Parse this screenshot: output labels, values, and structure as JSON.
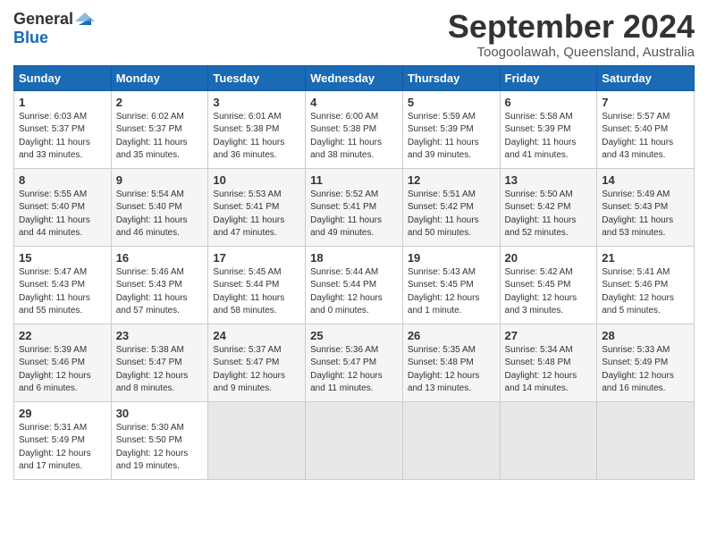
{
  "header": {
    "logo_general": "General",
    "logo_blue": "Blue",
    "month_title": "September 2024",
    "location": "Toogoolawah, Queensland, Australia"
  },
  "weekdays": [
    "Sunday",
    "Monday",
    "Tuesday",
    "Wednesday",
    "Thursday",
    "Friday",
    "Saturday"
  ],
  "weeks": [
    [
      {
        "day": "1",
        "info": "Sunrise: 6:03 AM\nSunset: 5:37 PM\nDaylight: 11 hours\nand 33 minutes."
      },
      {
        "day": "2",
        "info": "Sunrise: 6:02 AM\nSunset: 5:37 PM\nDaylight: 11 hours\nand 35 minutes."
      },
      {
        "day": "3",
        "info": "Sunrise: 6:01 AM\nSunset: 5:38 PM\nDaylight: 11 hours\nand 36 minutes."
      },
      {
        "day": "4",
        "info": "Sunrise: 6:00 AM\nSunset: 5:38 PM\nDaylight: 11 hours\nand 38 minutes."
      },
      {
        "day": "5",
        "info": "Sunrise: 5:59 AM\nSunset: 5:39 PM\nDaylight: 11 hours\nand 39 minutes."
      },
      {
        "day": "6",
        "info": "Sunrise: 5:58 AM\nSunset: 5:39 PM\nDaylight: 11 hours\nand 41 minutes."
      },
      {
        "day": "7",
        "info": "Sunrise: 5:57 AM\nSunset: 5:40 PM\nDaylight: 11 hours\nand 43 minutes."
      }
    ],
    [
      {
        "day": "8",
        "info": "Sunrise: 5:55 AM\nSunset: 5:40 PM\nDaylight: 11 hours\nand 44 minutes."
      },
      {
        "day": "9",
        "info": "Sunrise: 5:54 AM\nSunset: 5:40 PM\nDaylight: 11 hours\nand 46 minutes."
      },
      {
        "day": "10",
        "info": "Sunrise: 5:53 AM\nSunset: 5:41 PM\nDaylight: 11 hours\nand 47 minutes."
      },
      {
        "day": "11",
        "info": "Sunrise: 5:52 AM\nSunset: 5:41 PM\nDaylight: 11 hours\nand 49 minutes."
      },
      {
        "day": "12",
        "info": "Sunrise: 5:51 AM\nSunset: 5:42 PM\nDaylight: 11 hours\nand 50 minutes."
      },
      {
        "day": "13",
        "info": "Sunrise: 5:50 AM\nSunset: 5:42 PM\nDaylight: 11 hours\nand 52 minutes."
      },
      {
        "day": "14",
        "info": "Sunrise: 5:49 AM\nSunset: 5:43 PM\nDaylight: 11 hours\nand 53 minutes."
      }
    ],
    [
      {
        "day": "15",
        "info": "Sunrise: 5:47 AM\nSunset: 5:43 PM\nDaylight: 11 hours\nand 55 minutes."
      },
      {
        "day": "16",
        "info": "Sunrise: 5:46 AM\nSunset: 5:43 PM\nDaylight: 11 hours\nand 57 minutes."
      },
      {
        "day": "17",
        "info": "Sunrise: 5:45 AM\nSunset: 5:44 PM\nDaylight: 11 hours\nand 58 minutes."
      },
      {
        "day": "18",
        "info": "Sunrise: 5:44 AM\nSunset: 5:44 PM\nDaylight: 12 hours\nand 0 minutes."
      },
      {
        "day": "19",
        "info": "Sunrise: 5:43 AM\nSunset: 5:45 PM\nDaylight: 12 hours\nand 1 minute."
      },
      {
        "day": "20",
        "info": "Sunrise: 5:42 AM\nSunset: 5:45 PM\nDaylight: 12 hours\nand 3 minutes."
      },
      {
        "day": "21",
        "info": "Sunrise: 5:41 AM\nSunset: 5:46 PM\nDaylight: 12 hours\nand 5 minutes."
      }
    ],
    [
      {
        "day": "22",
        "info": "Sunrise: 5:39 AM\nSunset: 5:46 PM\nDaylight: 12 hours\nand 6 minutes."
      },
      {
        "day": "23",
        "info": "Sunrise: 5:38 AM\nSunset: 5:47 PM\nDaylight: 12 hours\nand 8 minutes."
      },
      {
        "day": "24",
        "info": "Sunrise: 5:37 AM\nSunset: 5:47 PM\nDaylight: 12 hours\nand 9 minutes."
      },
      {
        "day": "25",
        "info": "Sunrise: 5:36 AM\nSunset: 5:47 PM\nDaylight: 12 hours\nand 11 minutes."
      },
      {
        "day": "26",
        "info": "Sunrise: 5:35 AM\nSunset: 5:48 PM\nDaylight: 12 hours\nand 13 minutes."
      },
      {
        "day": "27",
        "info": "Sunrise: 5:34 AM\nSunset: 5:48 PM\nDaylight: 12 hours\nand 14 minutes."
      },
      {
        "day": "28",
        "info": "Sunrise: 5:33 AM\nSunset: 5:49 PM\nDaylight: 12 hours\nand 16 minutes."
      }
    ],
    [
      {
        "day": "29",
        "info": "Sunrise: 5:31 AM\nSunset: 5:49 PM\nDaylight: 12 hours\nand 17 minutes."
      },
      {
        "day": "30",
        "info": "Sunrise: 5:30 AM\nSunset: 5:50 PM\nDaylight: 12 hours\nand 19 minutes."
      },
      {
        "day": "",
        "info": ""
      },
      {
        "day": "",
        "info": ""
      },
      {
        "day": "",
        "info": ""
      },
      {
        "day": "",
        "info": ""
      },
      {
        "day": "",
        "info": ""
      }
    ]
  ]
}
